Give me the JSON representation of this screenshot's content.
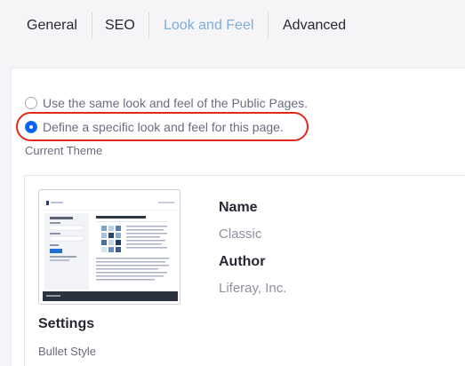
{
  "tabs": [
    {
      "label": "General",
      "active": false
    },
    {
      "label": "SEO",
      "active": false
    },
    {
      "label": "Look and Feel",
      "active": true
    },
    {
      "label": "Advanced",
      "active": false
    }
  ],
  "look_and_feel": {
    "options": [
      {
        "label": "Use the same look and feel of the Public Pages.",
        "checked": false
      },
      {
        "label": "Define a specific look and feel for this page.",
        "checked": true
      }
    ],
    "current_theme_label": "Current Theme",
    "theme": {
      "thumbnail_icon": "theme-preview-thumbnail",
      "name_label": "Name",
      "name": "Classic",
      "author_label": "Author",
      "author": "Liferay, Inc."
    },
    "settings_title": "Settings",
    "bullet_style_label": "Bullet Style"
  },
  "colors": {
    "active_tab": "#80acd9",
    "radio_checked": "#0b5fff",
    "highlight": "#e0291a",
    "muted_text": "#8f91a3"
  }
}
